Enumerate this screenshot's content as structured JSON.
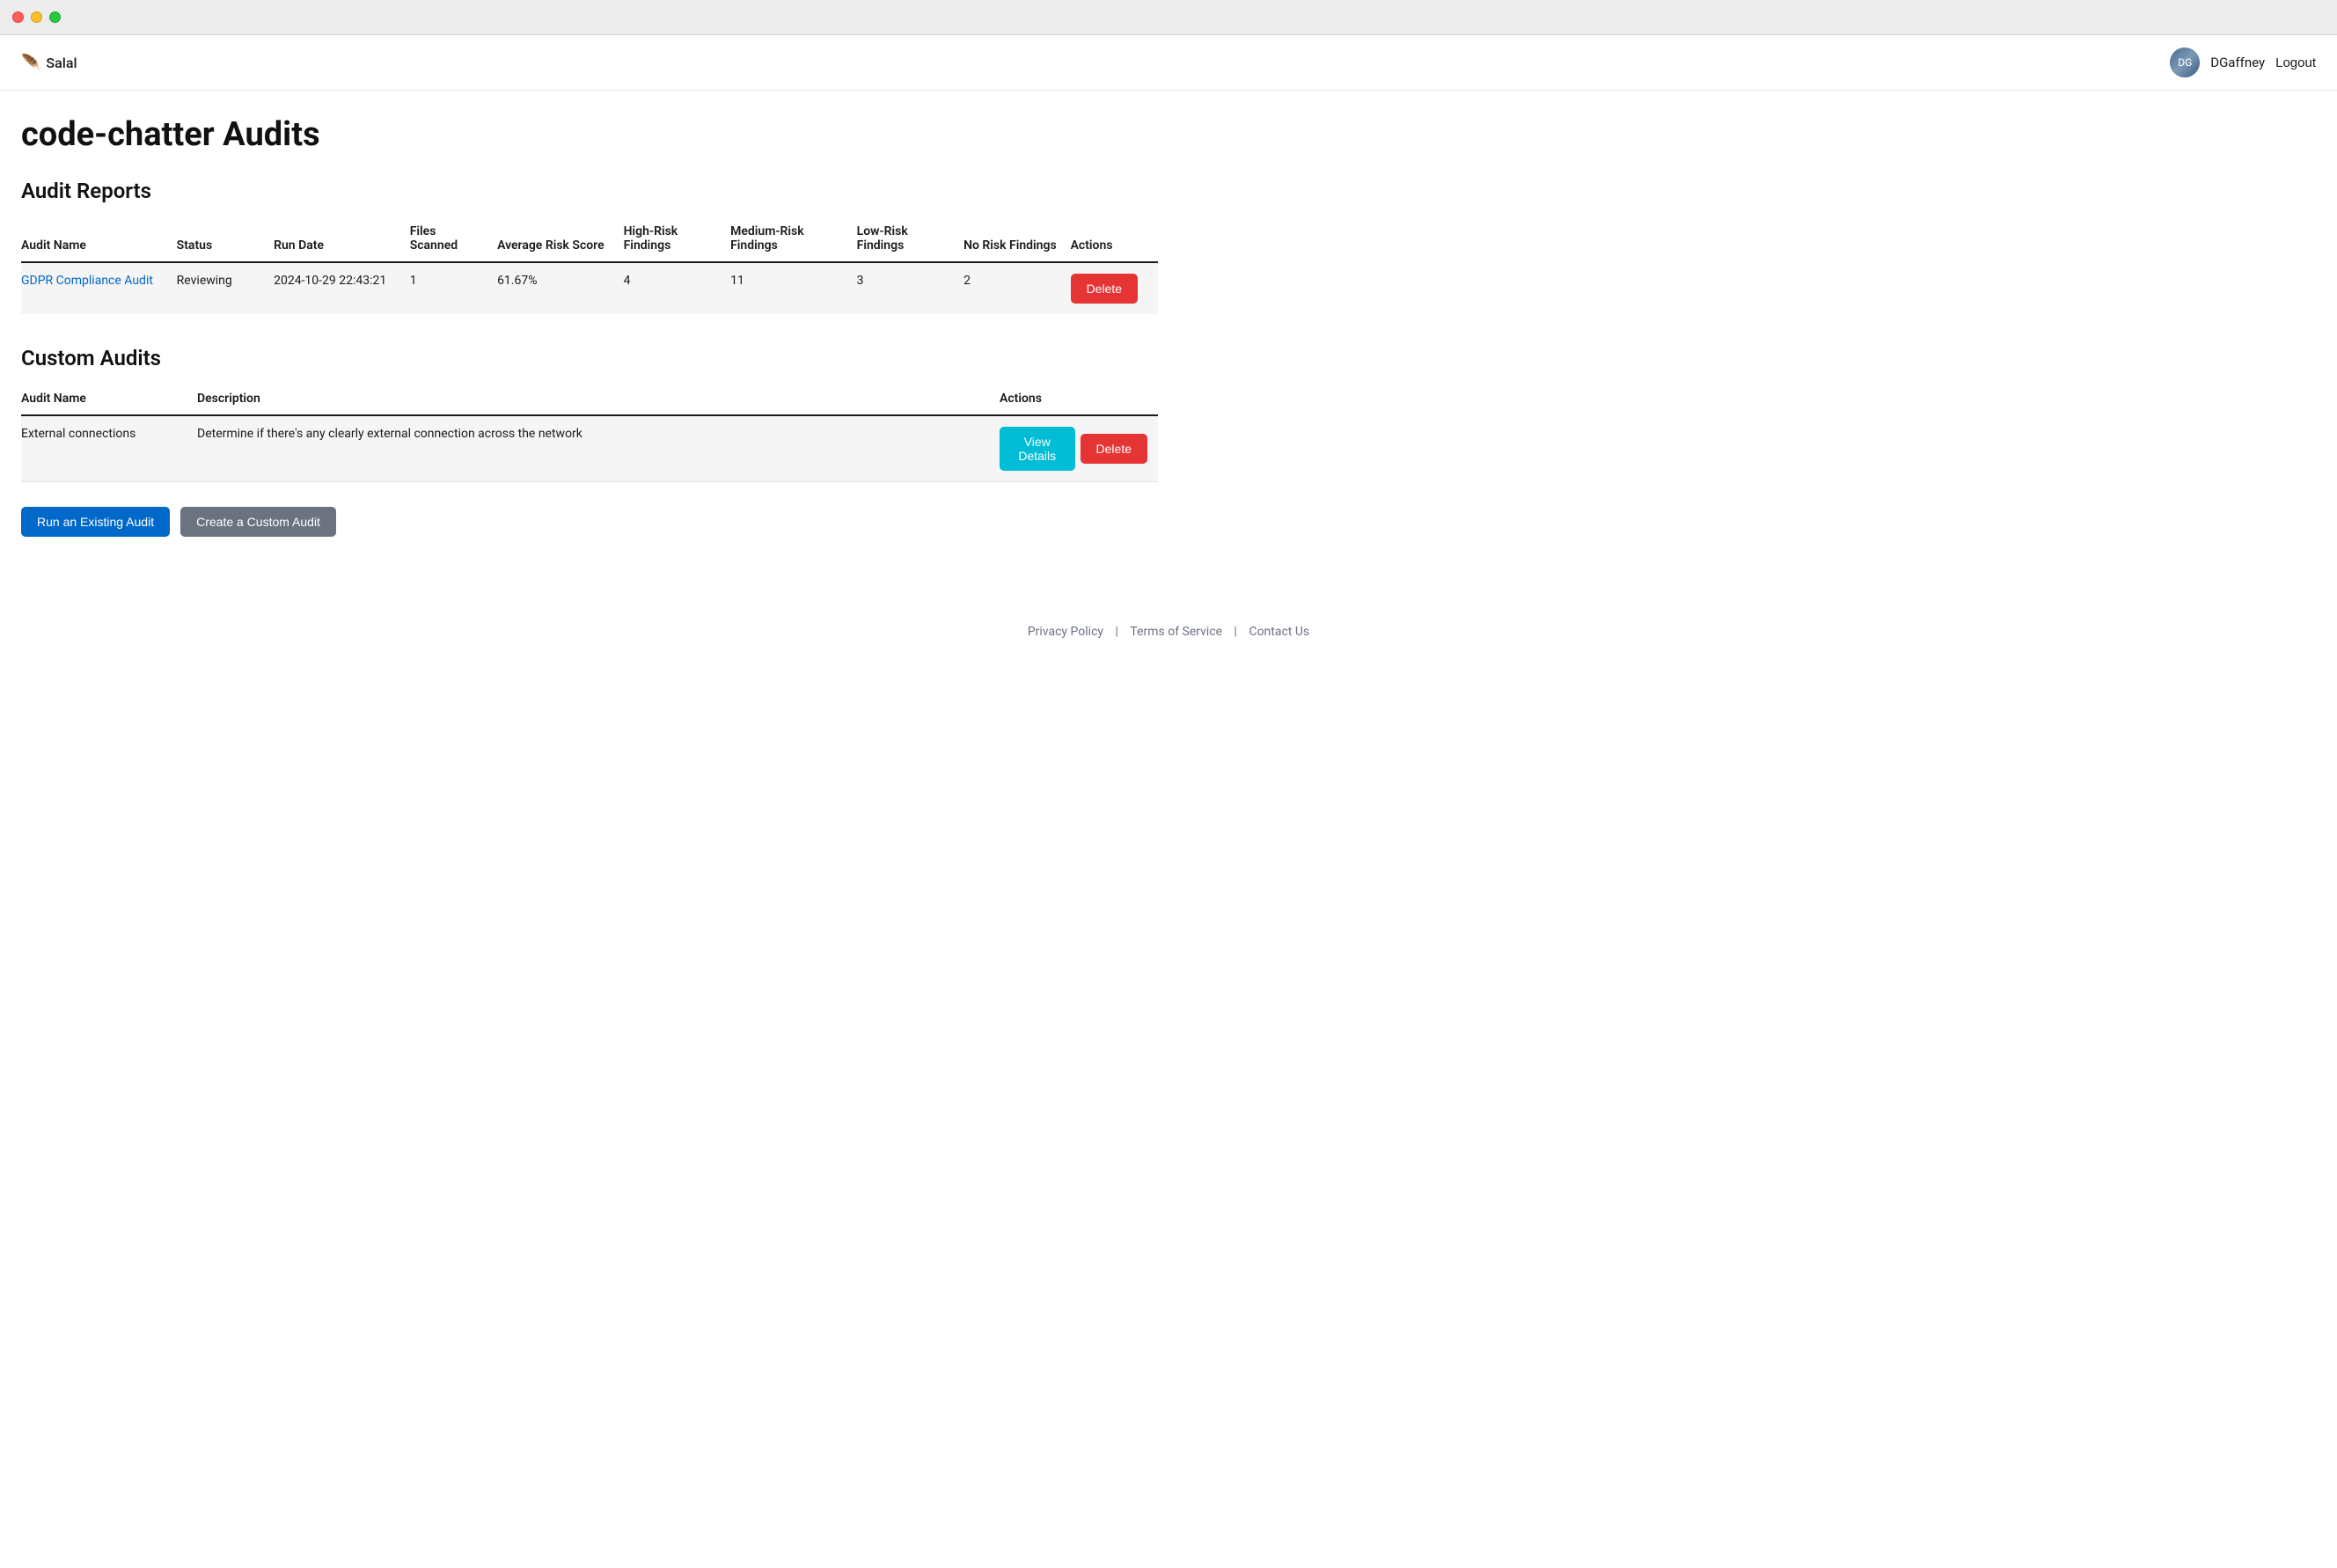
{
  "window": {
    "traffic_lights": [
      "red",
      "yellow",
      "green"
    ]
  },
  "header": {
    "logo_icon": "🪶",
    "logo_text": "Salal",
    "username": "DGaffney",
    "logout_label": "Logout"
  },
  "page": {
    "title": "code-chatter Audits"
  },
  "audit_reports": {
    "section_title": "Audit Reports",
    "columns": [
      {
        "key": "audit_name",
        "label": "Audit Name"
      },
      {
        "key": "status",
        "label": "Status"
      },
      {
        "key": "run_date",
        "label": "Run Date"
      },
      {
        "key": "files_scanned",
        "label": "Files Scanned"
      },
      {
        "key": "avg_risk_score",
        "label": "Average Risk Score"
      },
      {
        "key": "high_risk",
        "label": "High-Risk Findings"
      },
      {
        "key": "medium_risk",
        "label": "Medium-Risk Findings"
      },
      {
        "key": "low_risk",
        "label": "Low-Risk Findings"
      },
      {
        "key": "no_risk",
        "label": "No Risk Findings"
      },
      {
        "key": "actions",
        "label": "Actions"
      }
    ],
    "rows": [
      {
        "audit_name": "GDPR Compliance Audit",
        "audit_href": "#",
        "status": "Reviewing",
        "run_date": "2024-10-29 22:43:21",
        "files_scanned": "1",
        "avg_risk_score": "61.67%",
        "high_risk": "4",
        "medium_risk": "11",
        "low_risk": "3",
        "no_risk": "2",
        "delete_label": "Delete"
      }
    ]
  },
  "custom_audits": {
    "section_title": "Custom Audits",
    "columns": [
      {
        "key": "audit_name",
        "label": "Audit Name"
      },
      {
        "key": "description",
        "label": "Description"
      },
      {
        "key": "actions",
        "label": "Actions"
      }
    ],
    "rows": [
      {
        "audit_name": "External connections",
        "description": "Determine if there's any clearly external connection across the network",
        "view_details_label": "View Details",
        "delete_label": "Delete"
      }
    ]
  },
  "footer_actions": {
    "run_existing_label": "Run an Existing Audit",
    "create_custom_label": "Create a Custom Audit"
  },
  "footer": {
    "links": [
      {
        "label": "Privacy Policy",
        "href": "#"
      },
      {
        "label": "Terms of Service",
        "href": "#"
      },
      {
        "label": "Contact Us",
        "href": "#"
      }
    ],
    "separator": "|"
  }
}
